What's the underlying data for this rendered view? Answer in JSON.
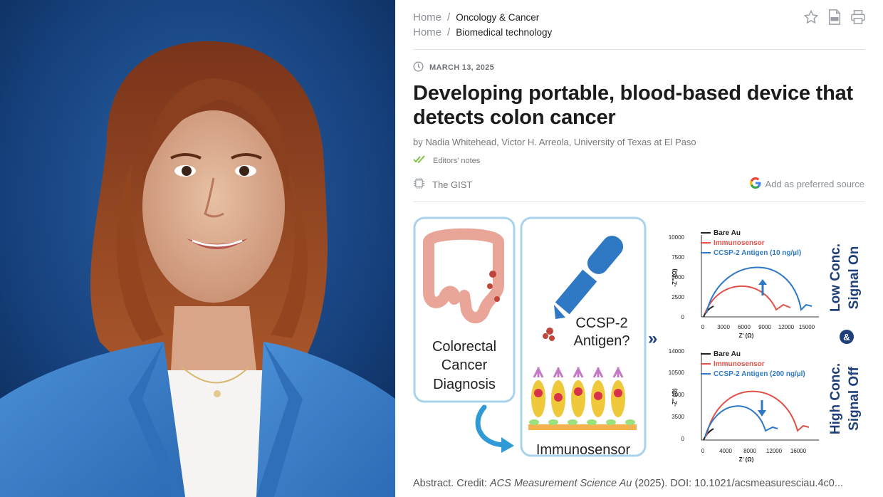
{
  "breadcrumbs": [
    {
      "home": "Home",
      "sep": "/",
      "category": "Oncology & Cancer"
    },
    {
      "home": "Home",
      "sep": "/",
      "category": "Biomedical technology"
    }
  ],
  "toolbar": {
    "icons": [
      "star-icon",
      "pdf-icon",
      "print-icon"
    ]
  },
  "article": {
    "date": "MARCH 13, 2025",
    "title": "Developing portable, blood-based device that detects colon cancer",
    "byline": "by Nadia Whitehead, Victor H. Arreola, University of Texas at El Paso",
    "editors_notes": "Editors' notes",
    "gist": "The GIST",
    "preferred_source": "Add as preferred source"
  },
  "figure": {
    "panel1_line1": "Colorectal",
    "panel1_line2": "Cancer",
    "panel1_line3": "Diagnosis",
    "antigen_line1": "CCSP-2",
    "antigen_line2": "Antigen?",
    "immunosensor": "Immunosensor",
    "arrows": "»",
    "amp": "&",
    "side_top_1": "Low Conc.",
    "side_top_2": "Signal On",
    "side_bot_1": "High Conc.",
    "side_bot_2": "Signal Off",
    "x_axis_label": "Z' (Ω)",
    "y_axis_label": "-Z'' (Ω)",
    "top_plot": {
      "legend": [
        "Bare Au",
        "Immunosensor",
        "CCSP-2 Antigen (10 ng/µl)"
      ],
      "yticks": [
        "10000",
        "7500",
        "5000",
        "2500",
        "0"
      ],
      "xticks": [
        "0",
        "3000",
        "6000",
        "9000",
        "12000",
        "15000"
      ]
    },
    "bottom_plot": {
      "legend": [
        "Bare Au",
        "Immunosensor",
        "CCSP-2 Antigen (200 ng/µl)"
      ],
      "yticks": [
        "14000",
        "10500",
        "7000",
        "3500",
        "0"
      ],
      "xticks": [
        "0",
        "4000",
        "8000",
        "12000",
        "16000"
      ]
    }
  },
  "caption": {
    "prefix": "Abstract. Credit: ",
    "journal": "ACS Measurement Science Au",
    "suffix": " (2025). DOI: 10.1021/acsmeasuresciau.4c0..."
  },
  "colors": {
    "blazer": "#3d7fc9",
    "hair": "#8a3f1f",
    "background": "#123f78",
    "accent_blue": "#2f78c4",
    "accent_red": "#e0514a",
    "editors_check": "#7bbf3a"
  }
}
